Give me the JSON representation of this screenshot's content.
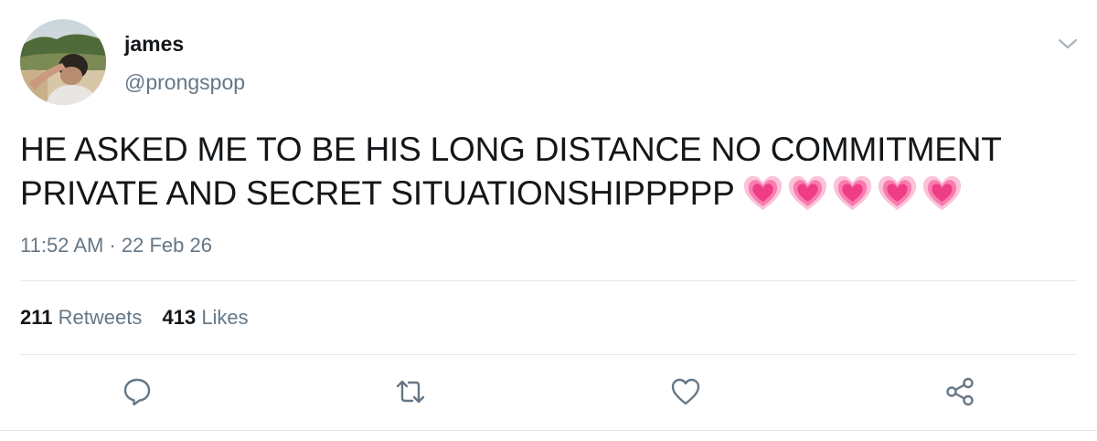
{
  "user": {
    "name": "james",
    "handle": "@prongspop"
  },
  "tweet": {
    "line1": "HE ASKED ME TO BE HIS LONG DISTANCE NO COMMITMENT",
    "line2": "PRIVATE AND SECRET SITUATIONSHIPPPPP",
    "emoji": [
      "growing-heart",
      "growing-heart",
      "growing-heart",
      "growing-heart",
      "growing-heart"
    ],
    "timestamp": "11:52 AM · 22 Feb 26"
  },
  "stats": {
    "retweets_count": "211",
    "retweets_label": "Retweets",
    "likes_count": "413",
    "likes_label": "Likes"
  },
  "actions": [
    "reply-icon",
    "retweet-icon",
    "like-icon",
    "share-icon"
  ],
  "colors": {
    "text": "#14171a",
    "secondary": "#657786",
    "divider": "#e1e8ed",
    "heart": "#f0458b"
  }
}
